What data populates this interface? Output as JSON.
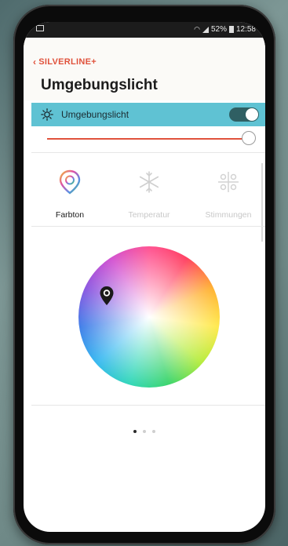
{
  "status_bar": {
    "battery": "52%",
    "time": "12:58"
  },
  "nav": {
    "back_label": "SILVERLINE+"
  },
  "page": {
    "title": "Umgebungslicht"
  },
  "light_toggle": {
    "label": "Umgebungslicht",
    "on": true
  },
  "brightness": {
    "value_fraction": 1.0
  },
  "tabs": [
    {
      "label": "Farbton",
      "active": true
    },
    {
      "label": "Temperatur",
      "active": false
    },
    {
      "label": "Stimmungen",
      "active": false
    }
  ],
  "pager": {
    "pages": 3,
    "current": 1
  },
  "colors": {
    "accent": "#e0523c",
    "toggle_row_bg": "#5fc2d3",
    "switch_bg": "#2f5f63"
  }
}
